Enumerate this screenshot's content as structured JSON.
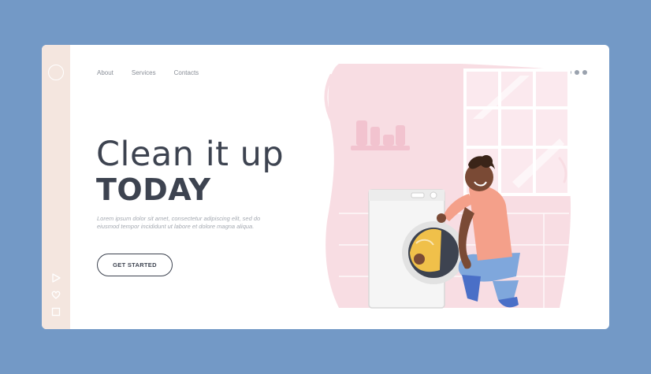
{
  "nav": {
    "items": [
      "About",
      "Services",
      "Contacts"
    ]
  },
  "hero": {
    "title_line1": "Clean it up",
    "title_line2": "TODAY",
    "body": "Lorem ipsum dolor sit amet, consectetur adipiscing elit, sed do eiusmod tempor incididunt ut labore et dolore magna aliqua.",
    "cta_label": "GET STARTED"
  },
  "side_rail": {
    "icons": [
      "circle-icon",
      "play-icon",
      "heart-icon",
      "square-icon"
    ]
  },
  "menu": {
    "icon": "more-dots-icon"
  },
  "colors": {
    "background": "#7399c6",
    "card": "#ffffff",
    "rail": "#f4e6df",
    "text": "#3d4350",
    "accent_pink": "#f8dde3"
  }
}
